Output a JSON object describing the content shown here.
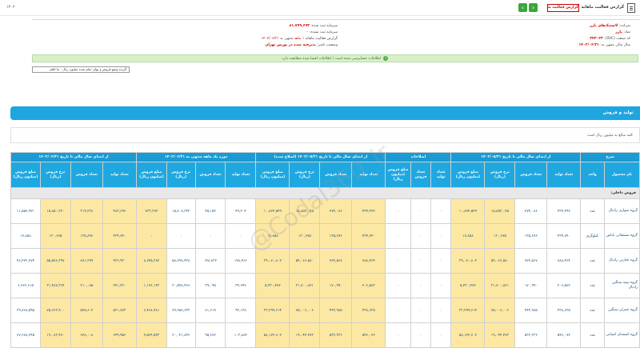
{
  "topbar": {
    "title": "گزارش فعالیت ماهانه",
    "badge": "گزارش فعالیت ماهانه",
    "left_label": "۱۴۰۲"
  },
  "info": {
    "company_label": "شرکت:",
    "company_value": "لاستیک‌های بارز",
    "symbol_label": "نماد:",
    "symbol_value": "پارز",
    "isic_label": "کد صنعت (ISIC):",
    "isic_value": "۳۴۳۰۲۳",
    "period_label": "سال مالی منتهی به:",
    "period_value": "۱۴۰۲/۰۶/۳۱",
    "capital_label": "سرمایه ثبت شده:",
    "capital_value": "۸۱,۷۹۹,۶۹۳",
    "unreg_capital_label": "سرمایه ثبت نشده:",
    "unreg_capital_value": "۰",
    "report_label": "گزارش فعالیت ماهانه",
    "report_month": "۱ ماهه",
    "report_end_label": "منتهی به",
    "report_end_value": "۱۴۰۲/۰۶/۳۱",
    "status_label": "وضعیت ناشر:",
    "status_value": "پذیرفته شده در بورس تهران"
  },
  "notice": "اطلاعات حسابرسی شده است / اطلاعات افشا شده مطابقت دارد",
  "select": {
    "value": "گزیده وضع فروش و بهای تمام شده میلیون ریال - ما افلم"
  },
  "section": {
    "title": "تولید و فروش",
    "note": "کلیه مبالغ به میلیون ریال است"
  },
  "table": {
    "groups": [
      "شرح",
      "از ابتدای سال مالی تا تاریخ ۱۴۰۲/۰۵/۳۱",
      "اصلاحات",
      "از ابتدای سال مالی تا تاریخ ۱۴۰۲/۰۵/۳۱ (اصلاح شده)",
      "دوره یک ماهه منتهی به ۱۴۰۲/۰۶/۳۱",
      "از ابتدای سال مالی تا تاریخ ۱۴۰۲/۰۶/۳۱"
    ],
    "headers": [
      "نام محصول",
      "واحد",
      "تعداد تولید",
      "تعداد فروش",
      "نرخ فروش (ریال)",
      "مبلغ فروش (میلیون ریال)",
      "تعداد تولید",
      "تعداد فروش",
      "مبلغ فروش (میلیون ریال)",
      "تعداد تولید",
      "تعداد فروش",
      "نرخ فروش (ریال)",
      "مبلغ فروش (میلیون ریال)",
      "تعداد تولید",
      "تعداد فروش",
      "نرخ فروش (ریال)",
      "مبلغ فروش (میلیون ریال)",
      "تعداد تولید",
      "تعداد فروش",
      "نرخ فروش (ریال)",
      "مبلغ فروش (میلیون ریال)"
    ],
    "section_row": "فروش داخلی:",
    "rows": [
      {
        "name": "گروه سواری رادیال",
        "unit": "عدد",
        "v": [
          "۴۳۴,۴۹۲",
          "۲۷۴,۰۸۶",
          "۱۵,۸۵۳,۰۴۵",
          "۱۰,۸۲۴,۵۴۹",
          "۰",
          "۰",
          "۰",
          "۴۳۴,۴۹۲",
          "۲۷۴,۰۸۶",
          "۱۵,۸۵۳,۰۴۵",
          "۱۰,۸۲۴,۵۴۹",
          "۴۹,۲۰۴",
          "۴۵,۱۵۲",
          "۱۵,۸۰۸,۳۴۳",
          "۷۳۳,۳۷۲",
          "۴۸۳,۶۹۶",
          "۳۱۹,۲۳۸",
          "۱۵,۸۵۰,۳۲۰",
          "۱۱,۵۵۷,۹۲۱",
          "۱۲,۸۳۰,۳۳۲",
          "۱۰,۳۰۶,۸۳۸"
        ]
      },
      {
        "name": "گروه مشتقاتی بایاس",
        "unit": "کیلوگرم",
        "v": [
          "۴۳۴,۷۴۰",
          "۱۳۵,۸۹۶",
          "۱۳۰,۶۷۵",
          "۱۷,۸۵۸",
          "۰",
          "۰",
          "۰",
          "۴۳۴,۷۴۰",
          "۱۳۵,۸۹۶",
          "۱۳۰,۶۷۵",
          "۱۷,۸۵۸",
          "۰",
          "۰",
          "۰",
          "۰",
          "۴۳۴,۷۴۰",
          "۱۳۵,۸۹۶",
          "۱۳۰,۶۷۵",
          "۱۷,۸۵۸",
          "۲۳,۵۸۴",
          "۱,۰۰۸"
        ]
      },
      {
        "name": "گروه تجارتی رادیال",
        "unit": "عدد",
        "v": [
          "۷۸۸,۴۶۴",
          "۷۲۲,۵۶۷",
          "۵۴,۰۶۶,۵۸۰",
          "۳۹,۰۷۰,۸۰۲",
          "۰",
          "۰",
          "۰",
          "۷۸۸,۴۶۴",
          "۷۲۲,۵۶۷",
          "۵۴,۰۶۶,۵۸۰",
          "۳۹,۰۷۰,۸۰۲",
          "۱۴۸,۴۶۶",
          "۱۴۸,۷۳۲",
          "۵۸,۷۹۸,۴۳۸",
          "۸,۷۴۵,۳۸۲",
          "۹۳۶,۹۳۰",
          "۸۷۱,۲۹۹",
          "۵۵,۵۷۶,۳۹۷",
          "۴۸,۴۲۲,۲۷۴",
          "۹۵۳,۹۶۷",
          "۴۰,۶۴۳,۹۹۷"
        ]
      },
      {
        "name": "گروه نیمه سنگین رادیال",
        "unit": "عدد",
        "v": [
          "۲۰۶,۵۸۳",
          "۱۷۰,۹۹۰",
          "۳۱,۷۰۰,۸۲۱",
          "۵,۴۳۰,۴۷۲",
          "۰",
          "۰",
          "۰",
          "۲۰۶,۵۸۳",
          "۱۷۰,۹۹۰",
          "۳۱,۷۰۰,۸۲۱",
          "۵,۴۳۰,۴۷۲",
          "۳۴,۶۴۷",
          "۳۹,۰۹۵",
          "۳۰,۵۹۸,۴۶۶",
          "۱,۱۹۶,۱۴۳",
          "۲۴۱,۲۳۰",
          "۲۱۰,۰۸۵",
          "۳۱,۴۸۷,۳۶۴",
          "۶,۶۲۶,۶۱۵",
          "۲۳۳,۲۶۹",
          "۵,۸۲۹,۷۰۸"
        ]
      },
      {
        "name": "گروه عمران سنگین",
        "unit": "عدد",
        "v": [
          "۴۳۸,۶۳۵",
          "۴۴۳,۹۸۵",
          "۷۵,۰۰۶,۰۰۶",
          "۳۳,۲۹۹,۶۱۴",
          "۰",
          "۰",
          "۰",
          "۴۳۸,۶۳۵",
          "۴۴۳,۹۸۵",
          "۷۵,۰۰۶,۰۰۶",
          "۳۳,۲۹۹,۶۱۴",
          "۹۳,۱۳۸",
          "۸۱,۶۱۹",
          "۷۹,۲۵۸,۶۳۳",
          "۶,۴۶۸,۹۸۱",
          "۵۳۱,۷۷۳",
          "۵۲۵,۶۰۴",
          "۷۵,۶۶۳,۹۰۰",
          "۳۹,۷۶۸,۵۹۵",
          "۵۳۱,۷۷۳",
          "۲۶,۲۵۸,۴۹۰"
        ]
      },
      {
        "name": "گروه کیسه‌ای انسانی",
        "unit": "عدد",
        "v": [
          "۵۴۶,۰۷۲",
          "۵۳۲,۳۳۶",
          "۱۹,۰۴۴,۴۷۳",
          "۵۸,۱۲۲,۷۰۲",
          "۰",
          "۰",
          "۰",
          "۵۴۶,۰۷۲",
          "۵۳۲,۳۳۶",
          "۱۹,۰۴۴,۴۷۳",
          "۵۸,۱۲۲,۷۰۲",
          "۱۰۳,۸۸۴",
          "۹۵,۶۷۲",
          "۲۰,۰۴۱,۸۴۶",
          "۹,۵۶۴,۵۴۳",
          "۶۴۹,۹۵۶",
          "۶۲۸,۰۰۸",
          "۱۹,۰۸۳,۴۷۰",
          "۶۷,۶۸۷,۲۴۵",
          "۷۳۰,۴۹۶",
          "۵۴,۶۹۹,۱۳۲"
        ]
      }
    ]
  }
}
